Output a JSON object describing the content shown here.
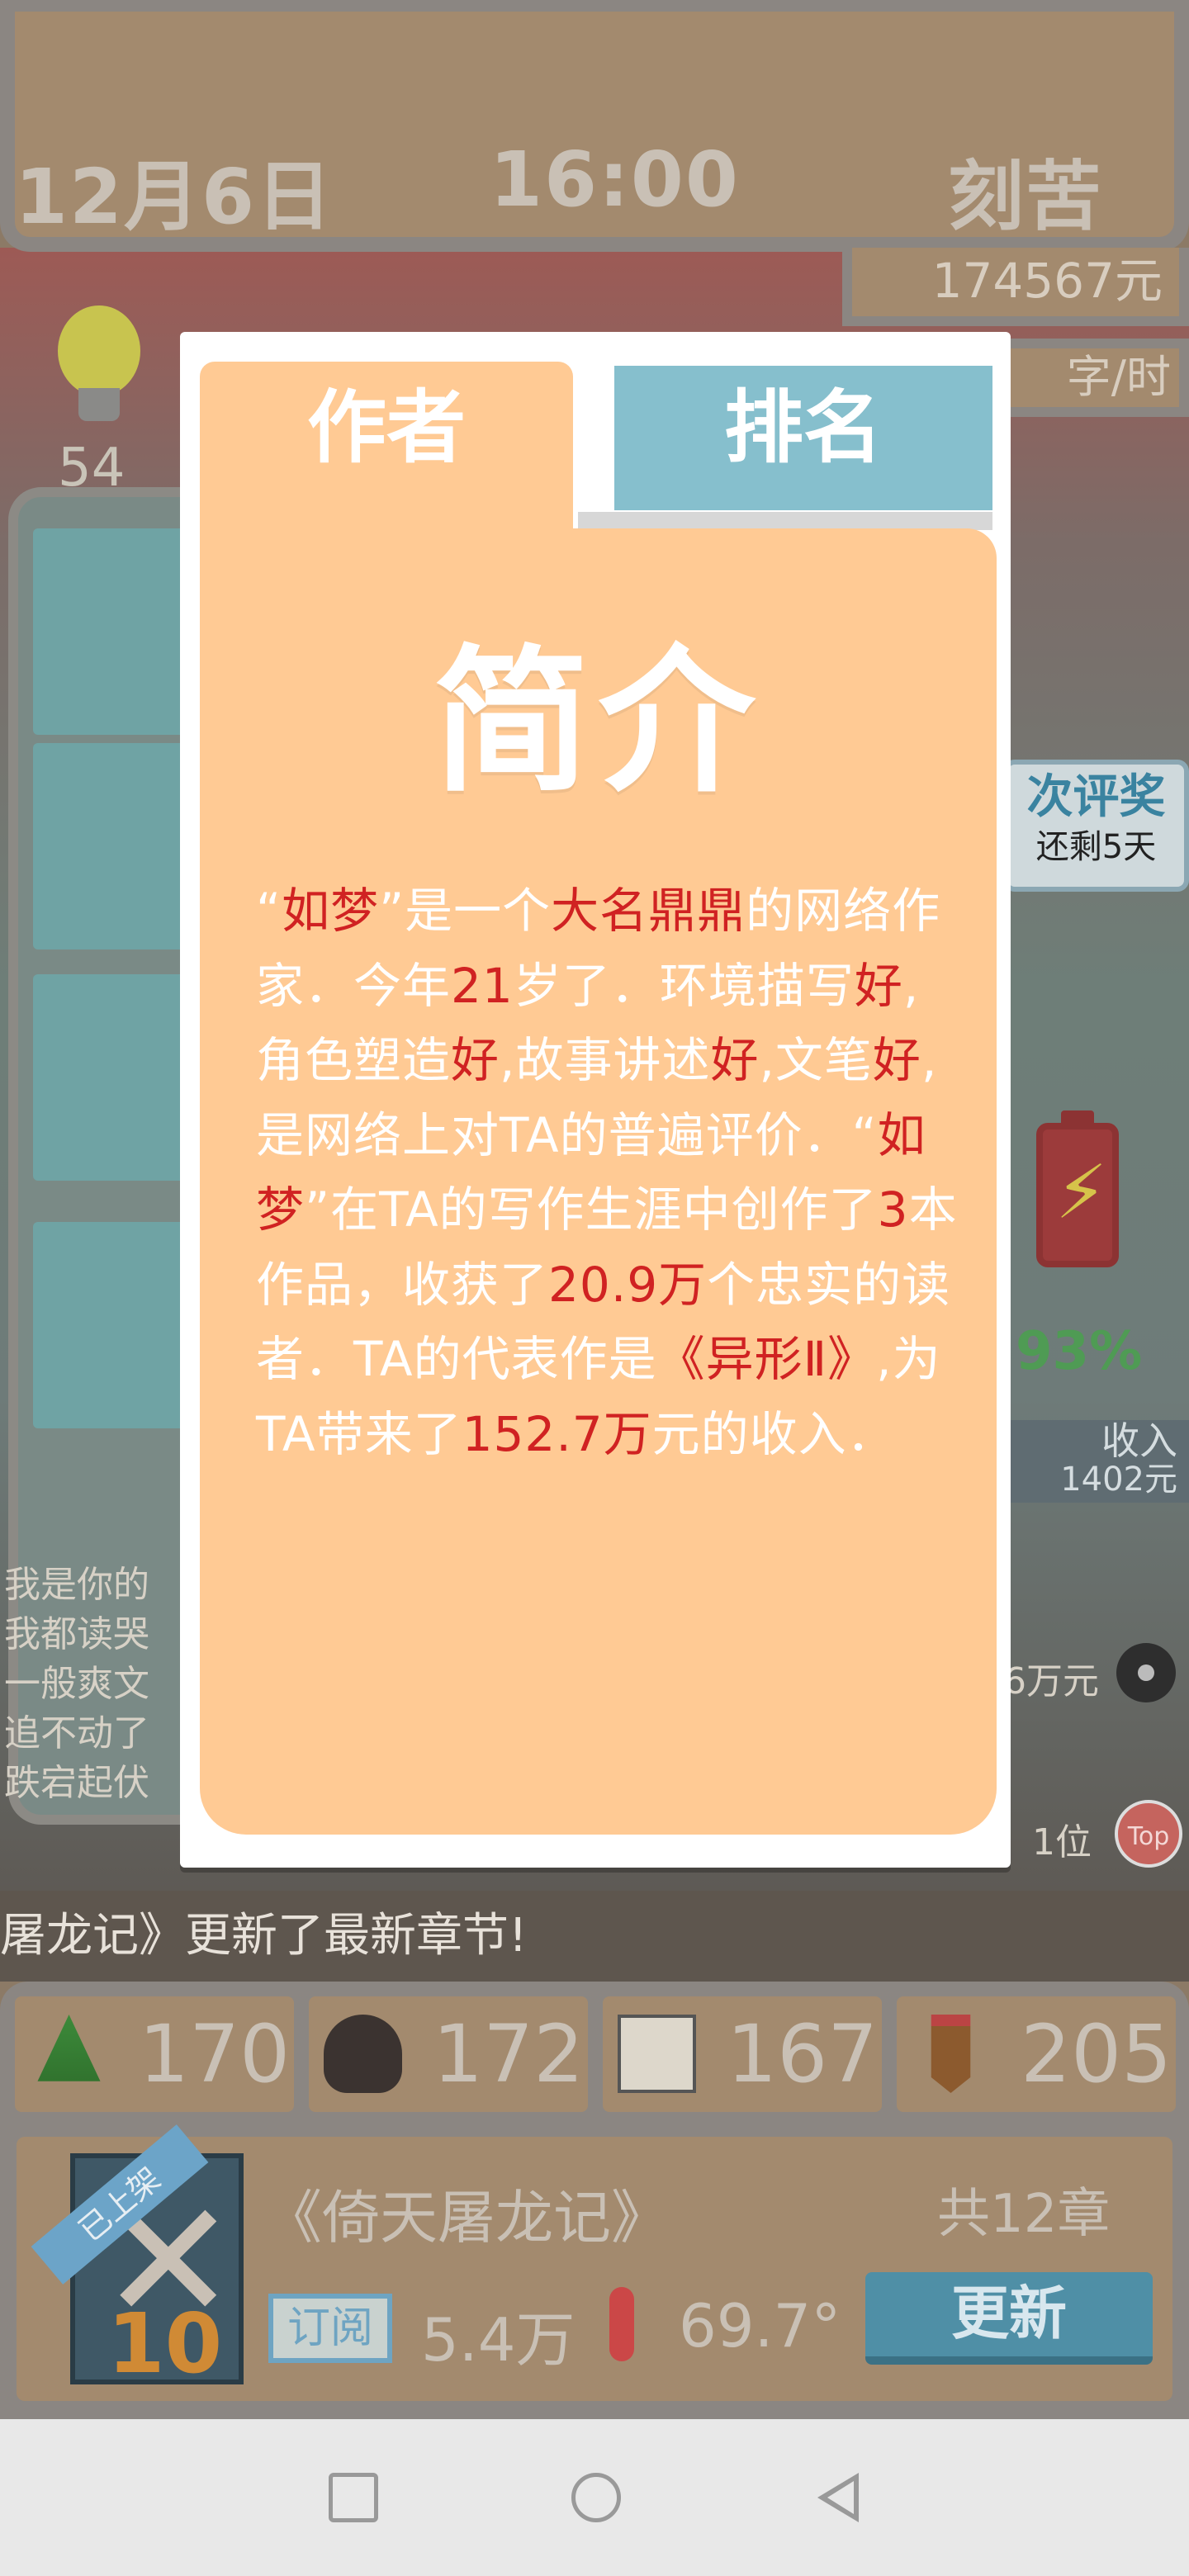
{
  "header": {
    "date": "12月6日",
    "time": "16:00",
    "mode": "刻苦",
    "money": "174567元",
    "speed": "字/时"
  },
  "hud": {
    "bulb_count": "54",
    "award_title": "次评奖",
    "award_days": "还剩5天",
    "battery_percent": "93%",
    "income_label": "收入",
    "income_value": "1402元",
    "revenue_text": "6万元",
    "rank_text": "1位",
    "top_label": "Top"
  },
  "reader_comments": [
    "我是你的",
    "我都读哭",
    "一般爽文",
    "追不动了",
    "跌宕起伏"
  ],
  "ticker": "屠龙记》更新了最新章节!",
  "stats": [
    {
      "icon": "tree-icon",
      "value": "170"
    },
    {
      "icon": "hat-icon",
      "value": "172"
    },
    {
      "icon": "book-icon",
      "value": "167"
    },
    {
      "icon": "pencil-icon",
      "value": "205"
    }
  ],
  "book": {
    "ribbon": "已上架",
    "cover_number": "10",
    "title": "《倚天屠龙记》",
    "chapters": "共12章",
    "subscribe_label": "订阅",
    "subscribers": "5.4万",
    "temperature": "69.7°",
    "update_label": "更新"
  },
  "modal": {
    "tab_author": "作者",
    "tab_rank": "排名",
    "title": "简介",
    "bio_segments": [
      {
        "t": "“",
        "h": false
      },
      {
        "t": "如梦",
        "h": true
      },
      {
        "t": "”是一个",
        "h": false
      },
      {
        "t": "大名鼎鼎",
        "h": true
      },
      {
        "t": "的网络作家．今年",
        "h": false
      },
      {
        "t": "21",
        "h": true
      },
      {
        "t": "岁了．环境描写",
        "h": false
      },
      {
        "t": "好",
        "h": true
      },
      {
        "t": ",角色塑造",
        "h": false
      },
      {
        "t": "好",
        "h": true
      },
      {
        "t": ",故事讲述",
        "h": false
      },
      {
        "t": "好",
        "h": true
      },
      {
        "t": ",文笔",
        "h": false
      },
      {
        "t": "好",
        "h": true
      },
      {
        "t": ",是网络上对TA的普遍评价．“",
        "h": false
      },
      {
        "t": "如梦",
        "h": true
      },
      {
        "t": "”在TA的写作生涯中创作了",
        "h": false
      },
      {
        "t": "3",
        "h": true
      },
      {
        "t": "本作品，收获了",
        "h": false
      },
      {
        "t": "20.9万",
        "h": true
      },
      {
        "t": "个忠实的读者．TA的代表作是",
        "h": false
      },
      {
        "t": "《异形Ⅱ》",
        "h": true
      },
      {
        "t": ",为TA带来了",
        "h": false
      },
      {
        "t": "152.7万",
        "h": true
      },
      {
        "t": "元的收入．",
        "h": false
      }
    ]
  },
  "colors": {
    "card": "#ffca94",
    "tab_rank": "#86bfcd",
    "highlight": "#d02222"
  }
}
